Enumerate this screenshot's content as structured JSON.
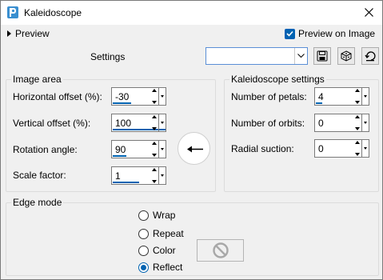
{
  "window": {
    "title": "Kaleidoscope"
  },
  "preview": {
    "toggle_label": "Preview",
    "on_image_label": "Preview on Image",
    "on_image_checked": true
  },
  "settings": {
    "label": "Settings",
    "combo_value": ""
  },
  "image_area": {
    "title": "Image area",
    "horizontal_offset": {
      "label": "Horizontal offset (%):",
      "value": "-30",
      "fill": 0.35
    },
    "vertical_offset": {
      "label": "Vertical offset (%):",
      "value": "100",
      "fill": 1.0
    },
    "rotation_angle": {
      "label": "Rotation angle:",
      "value": "90",
      "fill": 0.25
    },
    "scale_factor": {
      "label": "Scale factor:",
      "value": "1",
      "fill": 0.5
    }
  },
  "kaleidoscope_settings": {
    "title": "Kaleidoscope settings",
    "number_of_petals": {
      "label": "Number of petals:",
      "value": "4",
      "fill": 0.12
    },
    "number_of_orbits": {
      "label": "Number of orbits:",
      "value": "0"
    },
    "radial_suction": {
      "label": "Radial suction:",
      "value": "0"
    }
  },
  "edge_mode": {
    "title": "Edge mode",
    "options": [
      {
        "label": "Wrap",
        "selected": false
      },
      {
        "label": "Repeat",
        "selected": false
      },
      {
        "label": "Color",
        "selected": false
      },
      {
        "label": "Reflect",
        "selected": true
      }
    ]
  },
  "colors": {
    "accent": "#0063b1",
    "background": "#f0f0f0"
  }
}
